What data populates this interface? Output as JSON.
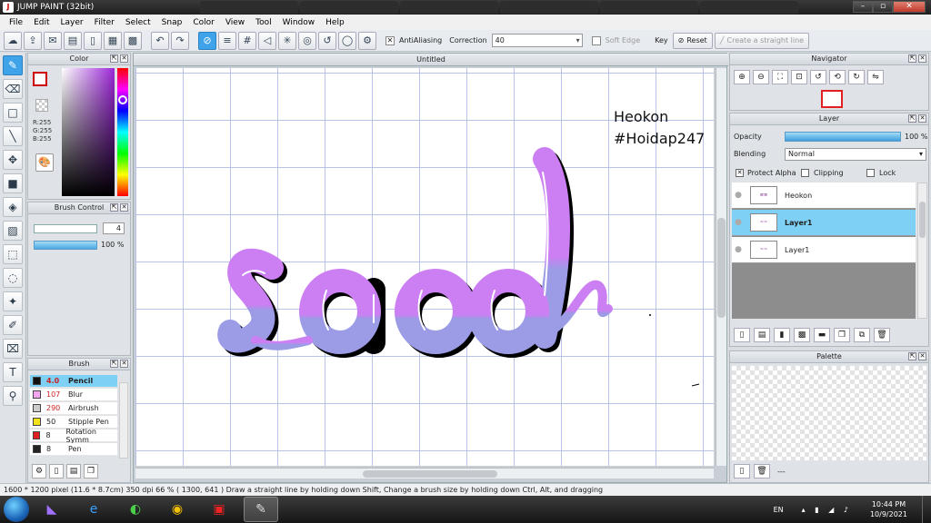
{
  "window": {
    "title": "JUMP PAINT (32bit)"
  },
  "menu": [
    "File",
    "Edit",
    "Layer",
    "Filter",
    "Select",
    "Snap",
    "Color",
    "View",
    "Tool",
    "Window",
    "Help"
  ],
  "toolbar": {
    "antialiasing_label": "AntiAliasing",
    "correction_label": "Correction",
    "correction_value": "40",
    "soft_edge_label": "Soft Edge",
    "key_label": "Key",
    "reset_label": "Reset",
    "straight_line_label": "Create a straight line"
  },
  "color_panel": {
    "title": "Color",
    "r": "R:255",
    "g": "G:255",
    "b": "B:255"
  },
  "brush_control": {
    "title": "Brush Control",
    "size_value": "4",
    "opacity_value": "100 %"
  },
  "brush_panel": {
    "title": "Brush",
    "items": [
      {
        "size": "4.0",
        "name": "Pencil",
        "color": "#111111"
      },
      {
        "size": "107",
        "name": "Blur",
        "color": "#f4a6f0"
      },
      {
        "size": "290",
        "name": "Airbrush",
        "color": "#cccccc"
      },
      {
        "size": "50",
        "name": "Stipple Pen",
        "color": "#f2e21a"
      },
      {
        "size": "8",
        "name": "Rotation Symm",
        "color": "#e02020"
      },
      {
        "size": "8",
        "name": "Pen",
        "color": "#222222"
      }
    ]
  },
  "canvas": {
    "tab_title": "Untitled",
    "text_line1": "Heokon",
    "text_line2": "#Hoidap247",
    "lettering_color_top": "#cc7ff2",
    "lettering_color_bottom": "#9b9be6"
  },
  "navigator": {
    "title": "Navigator"
  },
  "layer_panel": {
    "title": "Layer",
    "opacity_label": "Opacity",
    "opacity_value": "100 %",
    "blending_label": "Blending",
    "blending_value": "Normal",
    "protect_alpha_label": "Protect Alpha",
    "clipping_label": "Clipping",
    "lock_label": "Lock",
    "layers": [
      {
        "name": "Heokon",
        "selected": false
      },
      {
        "name": "Layer1",
        "selected": true
      },
      {
        "name": "Layer1",
        "selected": false
      }
    ]
  },
  "palette_panel": {
    "title": "Palette",
    "footer": "---"
  },
  "statusbar": {
    "text": "1600 * 1200 pixel   (11.6 * 8.7cm)   350 dpi   66 %   ( 1300, 641 )   Draw a straight line by holding down Shift, Change a brush size by holding down Ctrl, Alt, and dragging"
  },
  "taskbar": {
    "lang": "EN",
    "time": "10:44 PM",
    "date": "10/9/2021"
  }
}
